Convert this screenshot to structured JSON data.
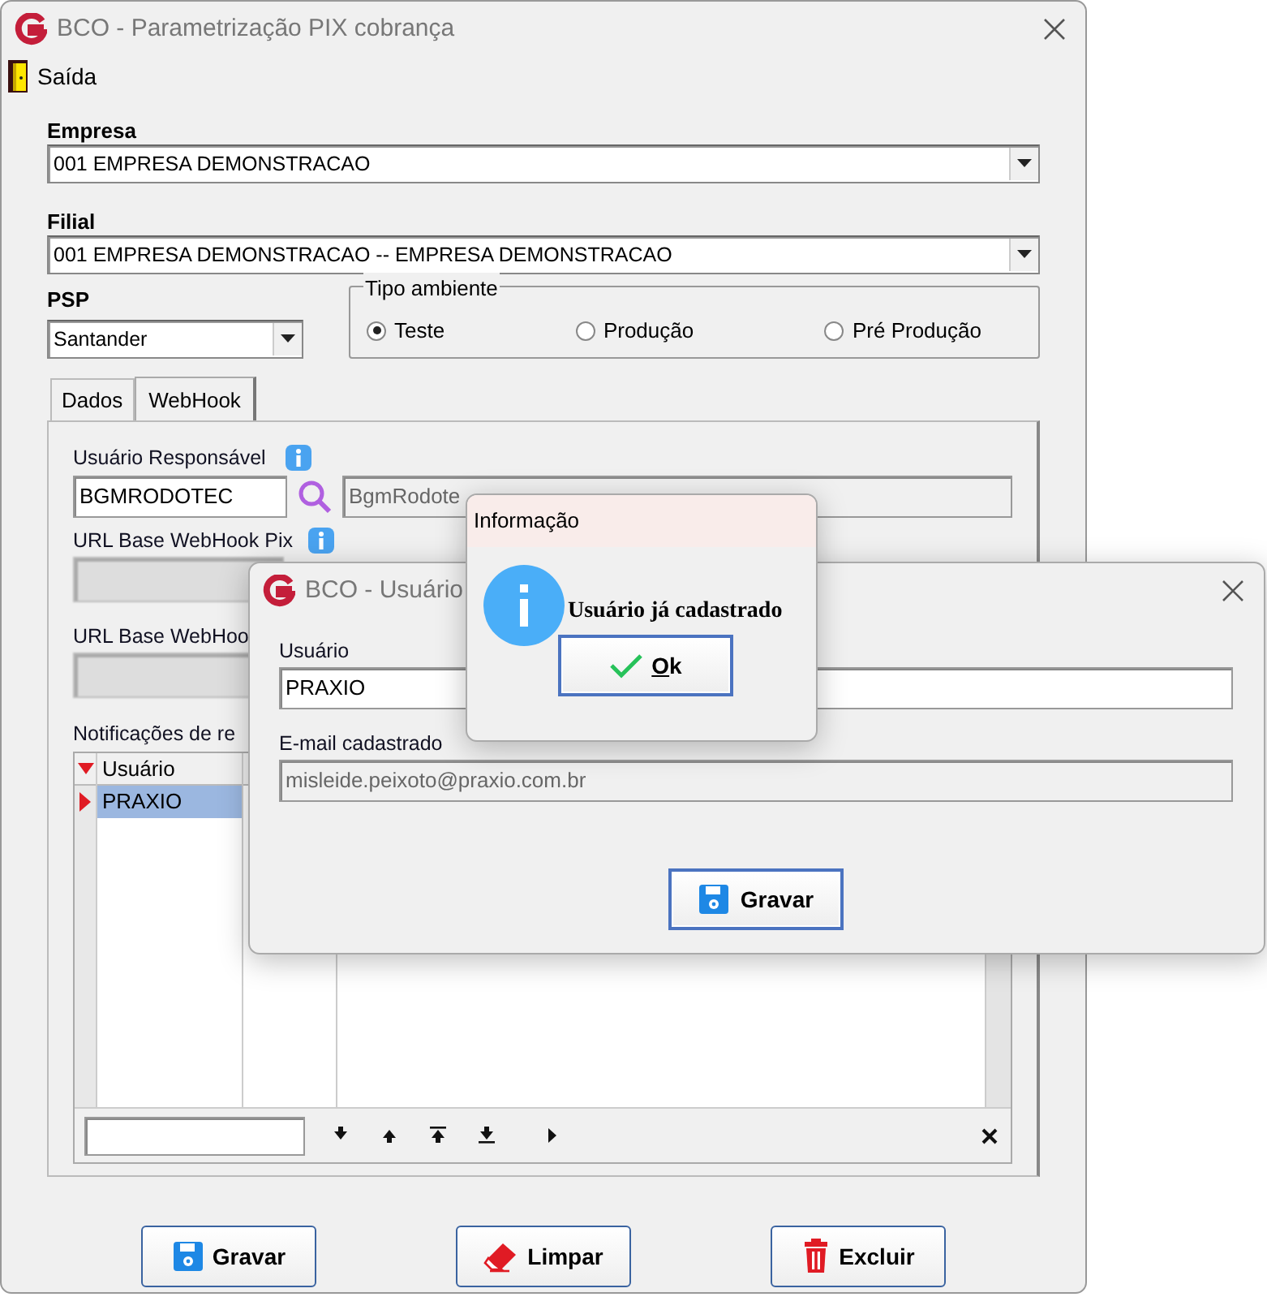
{
  "window": {
    "title": "BCO - Parametrização PIX cobrança"
  },
  "menu": [
    {
      "label": "Saída"
    }
  ],
  "empresa": {
    "label": "Empresa",
    "value": "001 EMPRESA DEMONSTRACAO"
  },
  "filial": {
    "label": "Filial",
    "value": "001 EMPRESA DEMONSTRACAO -- EMPRESA DEMONSTRACAO"
  },
  "psp": {
    "label": "PSP",
    "value": "Santander"
  },
  "tipo_ambiente": {
    "label": "Tipo ambiente",
    "options": [
      {
        "label": "Teste",
        "selected": true
      },
      {
        "label": "Produção",
        "selected": false
      },
      {
        "label": "Pré Produção",
        "selected": false
      }
    ]
  },
  "tabs": [
    {
      "label": "Dados",
      "selected": false
    },
    {
      "label": "WebHook",
      "selected": true
    }
  ],
  "webhook": {
    "usuario_responsavel": {
      "label": "Usuário Responsável",
      "code": "BGMRODOTEC",
      "name": "BgmRodote"
    },
    "url_pix": {
      "label": "URL Base WebHook Pix"
    },
    "url_2": {
      "label": "URL Base WebHoo"
    },
    "notificacoes": {
      "label": "Notificações de re",
      "columns": [
        "Usuário"
      ],
      "rows": [
        {
          "usuario": "PRAXIO",
          "selected": true
        }
      ]
    }
  },
  "buttons": [
    {
      "label": "Gravar",
      "kind": "save"
    },
    {
      "label": "Limpar",
      "kind": "clear"
    },
    {
      "label": "Excluir",
      "kind": "delete"
    }
  ],
  "user_dialog": {
    "title": "BCO - Usuário",
    "fields": [
      {
        "label": "Usuário",
        "value": "PRAXIO",
        "disabled": false
      },
      {
        "label": "E-mail cadastrado",
        "value": "misleide.peixoto@praxio.com.br",
        "disabled": true
      }
    ],
    "button": {
      "label": "Gravar",
      "kind": "save"
    }
  },
  "message_box": {
    "title": "Informação",
    "message": "Usuário já cadastrado",
    "button": {
      "label": "Ok"
    }
  }
}
